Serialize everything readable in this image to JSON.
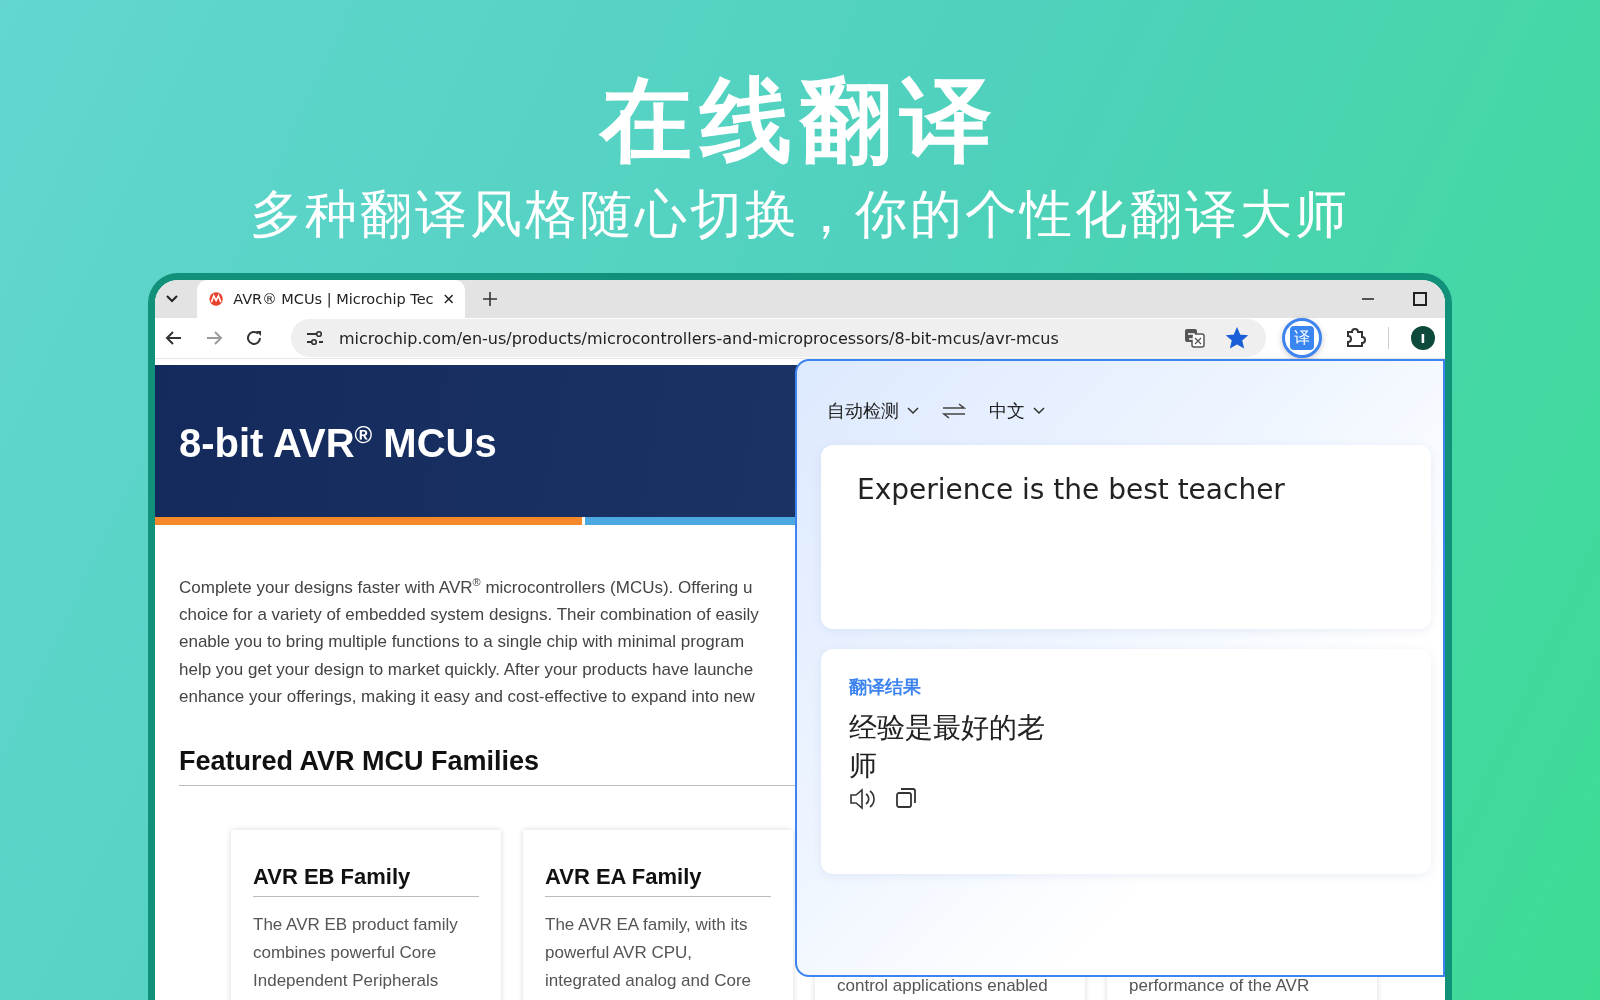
{
  "headline": "在线翻译",
  "subheadline": "多种翻译风格随心切换，你的个性化翻译大师",
  "browser": {
    "tabs": [
      {
        "title": "AVR® MCUs | Microchip Tec",
        "selected": true
      }
    ],
    "nav_buttons": [
      {
        "kind": "back",
        "disabled": false
      },
      {
        "kind": "forward",
        "disabled": true
      },
      {
        "kind": "reload",
        "disabled": false
      }
    ],
    "url": "microchip.com/en-us/products/microcontrollers-and-microprocessors/8-bit-mcus/avr-mcus",
    "bookmarked": true,
    "extension_active": true,
    "extension_glyph": "译",
    "avatar_letter": "I"
  },
  "page": {
    "hero_title": "8-bit AVR$^{®}$ MCUs",
    "intro_lines": [
      "Complete your designs faster with AVR$^{®}$ microcontrollers (MCUs). Offering u",
      "choice for a variety of embedded system designs. Their combination of easily",
      "enable you to bring multiple functions to a single chip with minimal program",
      "help you get your design to market quickly. After your products have launche",
      "enhance your offerings, making it easy and cost-effective to expand into new"
    ],
    "section_heading": "Featured AVR MCU Families",
    "cards": [
      {
        "kind": "full",
        "title": "AVR EB Family",
        "lines": [
          "The AVR EB product family",
          "combines powerful Core",
          "Independent Peripherals"
        ]
      },
      {
        "kind": "full",
        "title": "AVR EA Family",
        "lines": [
          "The AVR EA family, with its",
          "powerful AVR CPU,",
          "integrated analog and Core"
        ]
      },
      {
        "kind": "covered",
        "lines": [
          "control applications enabled"
        ]
      },
      {
        "kind": "covered",
        "lines": [
          "performance of the AVR"
        ]
      }
    ]
  },
  "translator": {
    "source_language": "自动检测",
    "target_language": "中文",
    "source_text": "Experience is the best teacher",
    "result_label": "翻译结果",
    "result_text": "经验是最好的老师"
  }
}
